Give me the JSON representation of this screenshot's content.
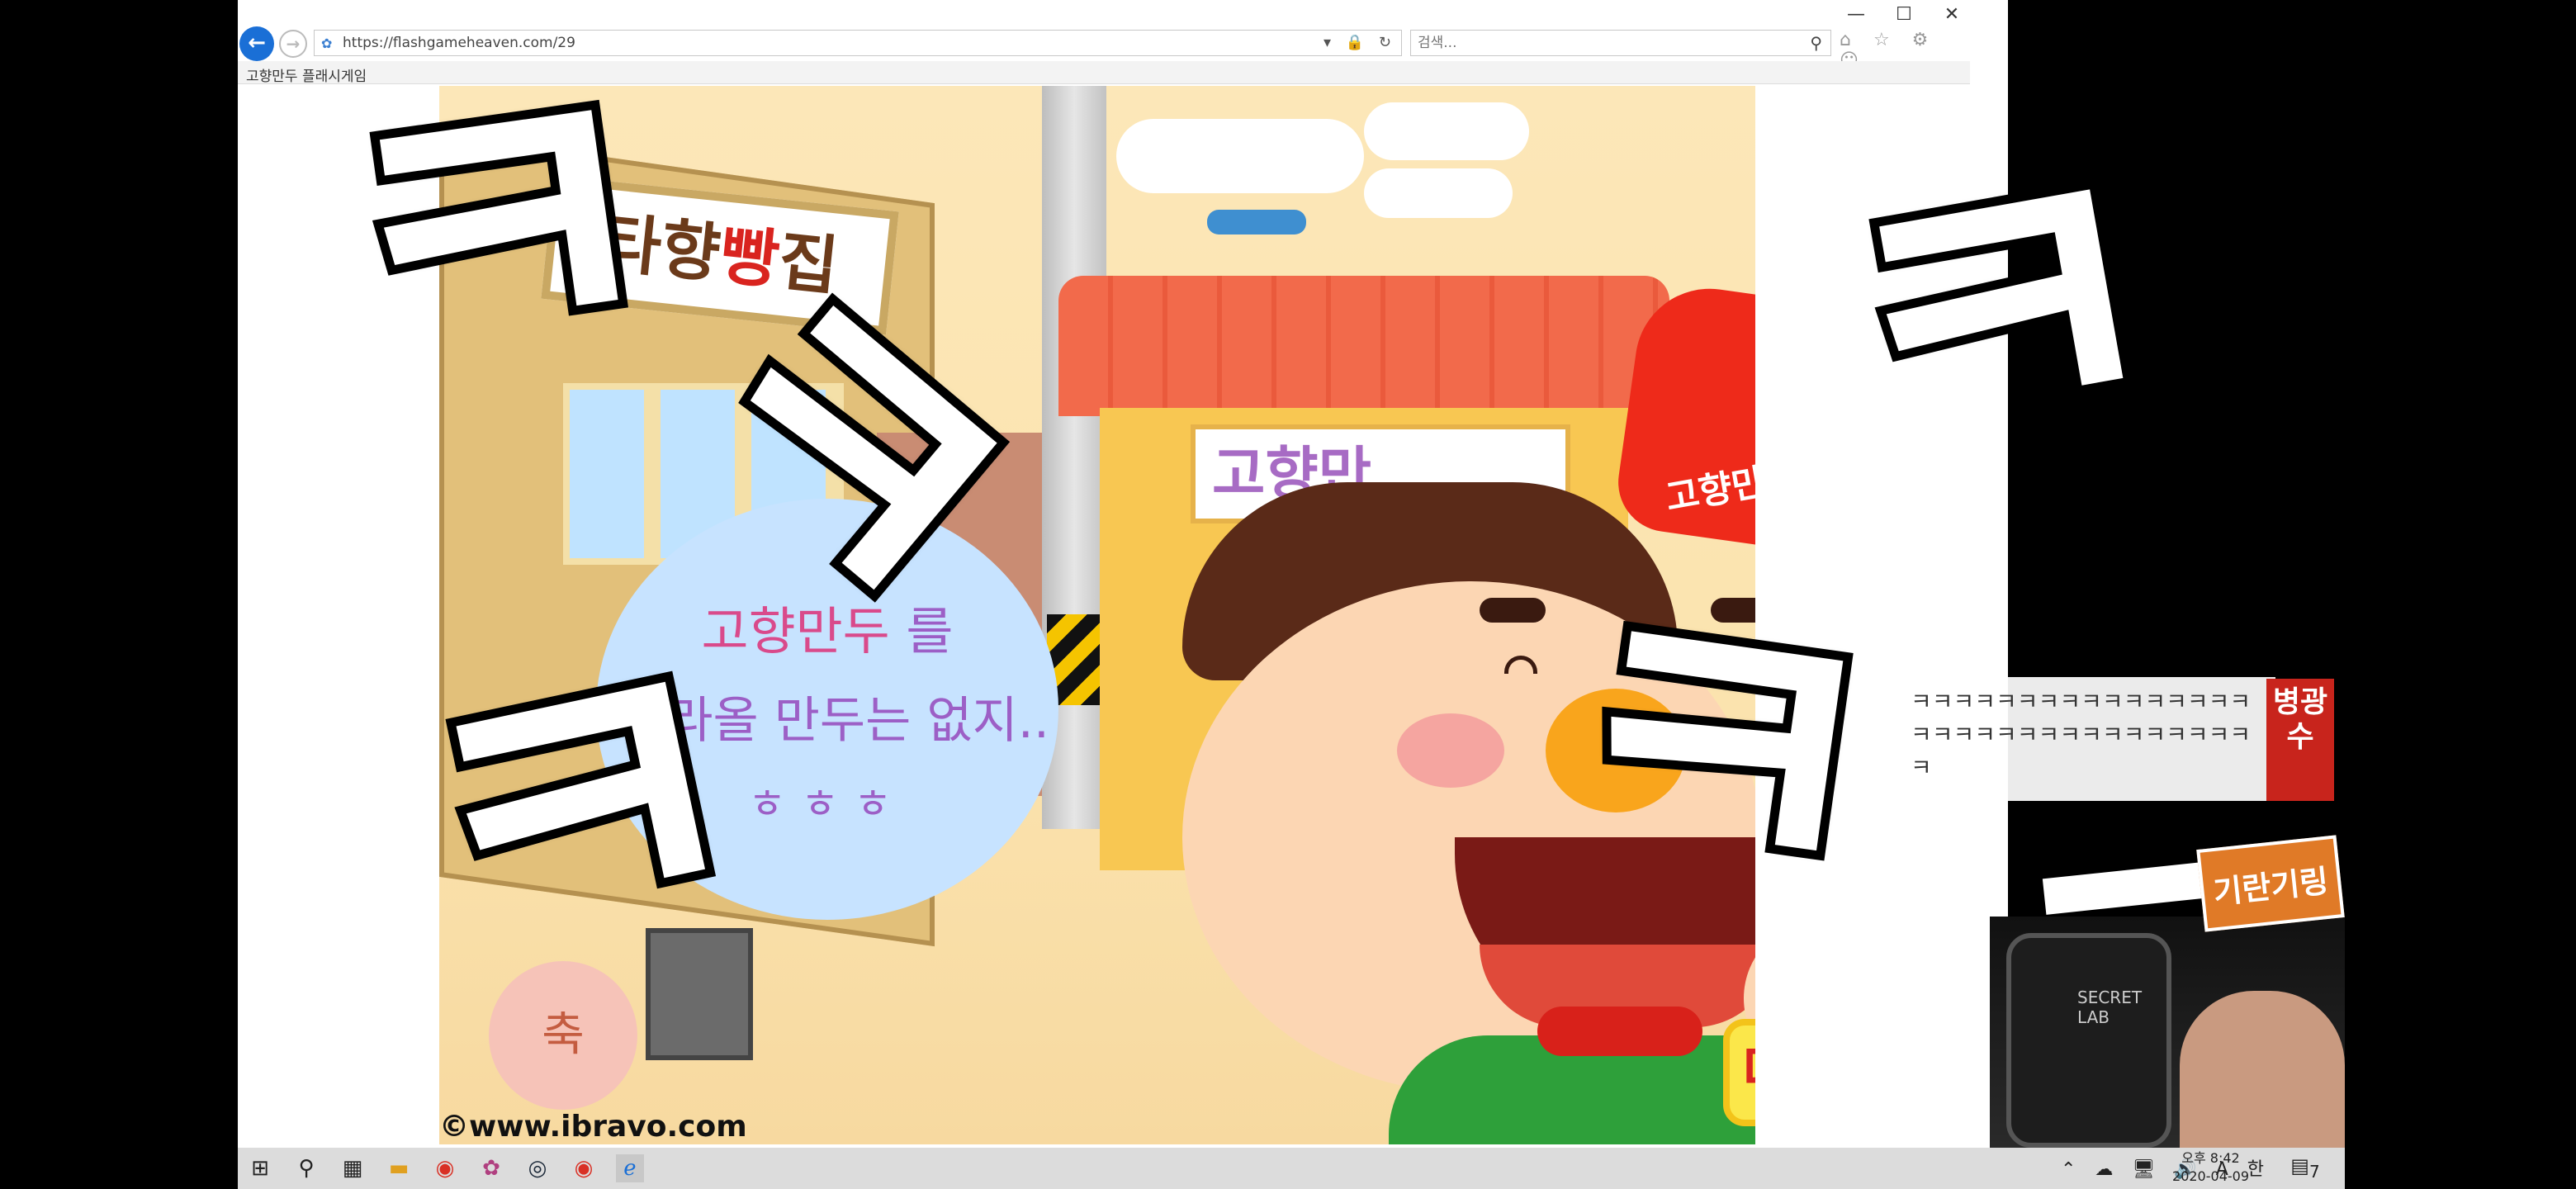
{
  "browser": {
    "url": "https://flashgameheaven.com/29",
    "search_placeholder": "검색...",
    "tab_title": "고향만두 플래시게임",
    "toolbar_icons": "⌂ ☆ ⚙ ☺",
    "addr_tools": "▾ 🔒 ↻",
    "win_minimize": "—",
    "win_maximize": "☐",
    "win_close": "✕"
  },
  "game": {
    "bakery_sign_a": "타향",
    "bakery_sign_b": "빵",
    "bakery_sign_c": "집",
    "shop_sign": "고향만",
    "hat_label": "고향만두",
    "bubble_line1_a": "고향만두",
    "bubble_line1_b": "를",
    "bubble_line2": "따라올 만두는 없지..",
    "bubble_line3": "ㅎㅎㅎ",
    "retry_button": "다시도전",
    "copyright": "©www.ibravo.com",
    "festival": "축"
  },
  "overlay": {
    "kk": "ㅋ",
    "chat_message": "ㅋㅋㅋㅋㅋㅋㅋㅋㅋㅋㅋㅋㅋㅋㅋㅋㅋㅋㅋㅋㅋㅋㅋㅋㅋㅋㅋㅋㅋㅋㅋㅋㅋ",
    "chat_name": "병광수",
    "sticker_label": "기란기링",
    "chair_logo": "SECRET LAB"
  },
  "taskbar": {
    "clock_time": "오후 8:42",
    "clock_date": "2020-04-09",
    "tray": "⌃ ☁ 🖥 🔊 A 한",
    "notif_count": "7"
  },
  "colors": {
    "accent_blue": "#1a6fd6",
    "retry_yellow": "#fbe74a",
    "hat_red": "#ee2a1a",
    "chat_red": "#c8241c"
  }
}
